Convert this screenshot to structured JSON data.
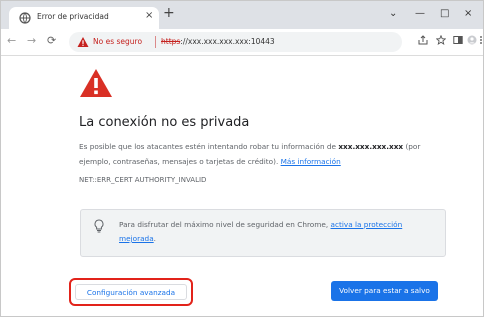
{
  "browser": {
    "tab": {
      "title": "Error de privacidad",
      "favicon": "globe-icon",
      "close": "×"
    },
    "new_tab": "+",
    "window_controls": {
      "tablist": "⌄",
      "minimize": "—",
      "maximize": "□",
      "close": "×"
    },
    "nav": {
      "back": "←",
      "forward": "→",
      "reload": "⟳"
    },
    "omnibox": {
      "security_label": "No es seguro",
      "url_scheme": "https",
      "url_rest": "://xxx.xxx.xxx.xxx:10443"
    },
    "toolbar_icons": [
      "share-icon",
      "star-icon",
      "sidebar-icon",
      "profile-icon",
      "menu-icon"
    ]
  },
  "page": {
    "heading": "La conexión no es privada",
    "paragraph": {
      "before": "Es posible que los atacantes estén intentando robar tu información de ",
      "host": "xxx.xxx.xxx.xxx",
      "after": " (por ejemplo, contraseñas, mensajes o tarjetas de crédito). ",
      "link": "Más información"
    },
    "error_code": "NET::ERR_CERT AUTHORITY_INVALID",
    "info": {
      "text": "Para disfrutar del máximo nivel de seguridad en Chrome, ",
      "link": "activa la protección mejorada",
      "end": "."
    },
    "advanced_button": "Configuración avanzada",
    "back_button": "Volver para estar a salvo"
  },
  "colors": {
    "accent": "#1a73e8",
    "danger": "#c5221f",
    "highlight": "#e2231a",
    "warning": "#d93025"
  }
}
